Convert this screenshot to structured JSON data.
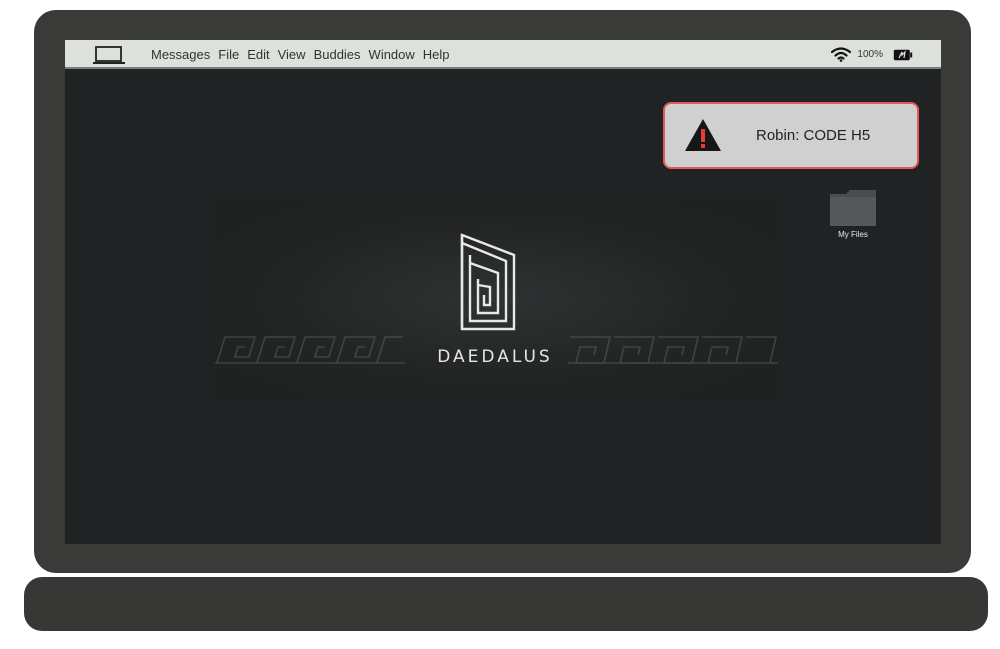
{
  "menubar": {
    "items": [
      "Messages",
      "File",
      "Edit",
      "View",
      "Buddies",
      "Window",
      "Help"
    ],
    "battery_label": "100%",
    "icons": [
      "laptop-icon",
      "wifi-icon",
      "battery-icon"
    ]
  },
  "notification": {
    "text": "Robin: CODE H5",
    "border_color": "#e0585a",
    "icon": "warning-icon"
  },
  "desktop": {
    "folder_label": "My Files"
  },
  "wallpaper": {
    "brand": "DAEDALUS"
  },
  "colors": {
    "laptop_body": "#3a3a39",
    "screen_bg": "#202223",
    "menubar_bg": "#dde1dc",
    "alert_red": "#e0585a"
  }
}
